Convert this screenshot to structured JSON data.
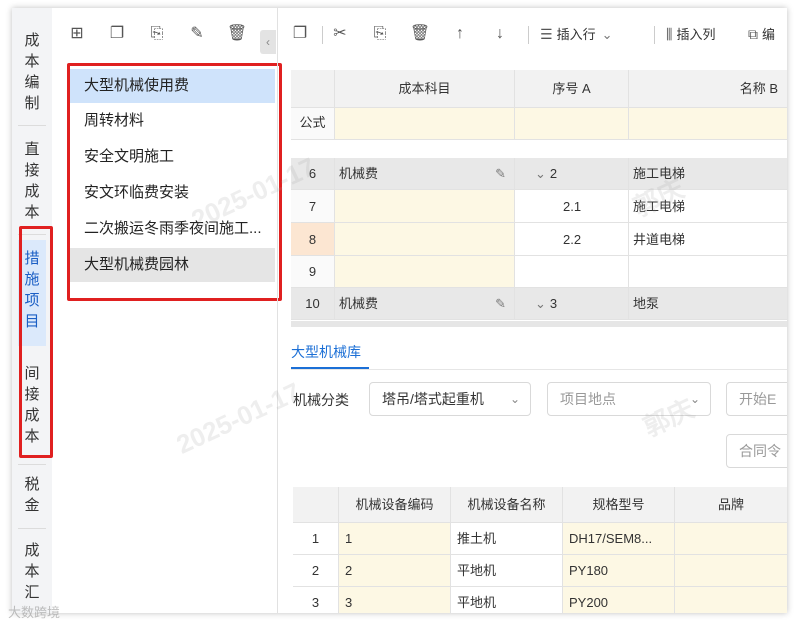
{
  "vnav": {
    "items": [
      {
        "label": "成本编制"
      },
      {
        "label": "直接成本"
      },
      {
        "label": "措施项目"
      },
      {
        "label": "间接成本"
      },
      {
        "label": "税金"
      },
      {
        "label": "成本汇"
      }
    ]
  },
  "list": {
    "items": [
      {
        "label": "大型机械使用费"
      },
      {
        "label": "周转材料"
      },
      {
        "label": "安全文明施工"
      },
      {
        "label": "安文环临费安装"
      },
      {
        "label": "二次搬运冬雨季夜间施工..."
      },
      {
        "label": "大型机械费园林"
      }
    ]
  },
  "toolbar": {
    "insert_row": "插入行",
    "insert_col": "插入列",
    "edit": "编"
  },
  "grid": {
    "headers": {
      "cost_subject": "成本科目",
      "seq": "序号 A",
      "name": "名称 B"
    },
    "formula_label": "公式",
    "rows": [
      {
        "num": "6",
        "subject": "机械费",
        "seq": "2",
        "name": "施工电梯"
      },
      {
        "num": "7",
        "subject": "",
        "seq": "2.1",
        "name": "施工电梯"
      },
      {
        "num": "8",
        "subject": "",
        "seq": "2.2",
        "name": "井道电梯"
      },
      {
        "num": "9",
        "subject": "",
        "seq": "",
        "name": ""
      },
      {
        "num": "10",
        "subject": "机械费",
        "seq": "3",
        "name": "地泵"
      }
    ]
  },
  "library": {
    "tab": "大型机械库",
    "filter_label": "机械分类",
    "category_value": "塔吊/塔式起重机",
    "location_placeholder": "项目地点",
    "start_placeholder": "开始E",
    "contract_placeholder": "合同令",
    "table": {
      "headers": {
        "code": "机械设备编码",
        "name": "机械设备名称",
        "spec": "规格型号",
        "brand": "品牌"
      },
      "rows": [
        {
          "idx": "1",
          "code": "1",
          "name": "推土机",
          "spec": "DH17/SEM8..."
        },
        {
          "idx": "2",
          "code": "2",
          "name": "平地机",
          "spec": "PY180"
        },
        {
          "idx": "3",
          "code": "3",
          "name": "平地机",
          "spec": "PY200"
        }
      ]
    }
  },
  "watermarks": {
    "name": "郭庆",
    "date": "2025-01-17"
  },
  "logo_text": "大数跨境",
  "colors": {
    "accent": "#1b6fd6",
    "highlight_frame": "#e02020",
    "selected": "#cfe3fb"
  }
}
